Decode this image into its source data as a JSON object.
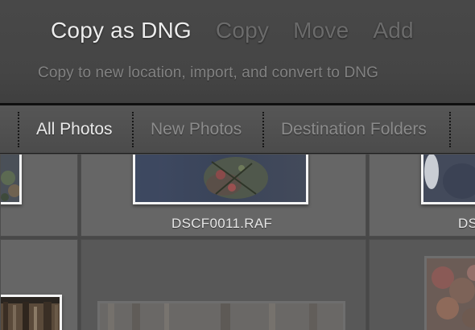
{
  "mode_tabs": [
    {
      "label": "Copy as DNG",
      "active": true
    },
    {
      "label": "Copy",
      "active": false
    },
    {
      "label": "Move",
      "active": false
    },
    {
      "label": "Add",
      "active": false
    }
  ],
  "mode_description": "Copy to new location, import, and convert to DNG",
  "filter_tabs": [
    {
      "label": "All Photos",
      "active": true
    },
    {
      "label": "New Photos",
      "active": false
    },
    {
      "label": "Destination Folders",
      "active": false
    }
  ],
  "grid": {
    "row1": [
      {
        "filename": ""
      },
      {
        "filename": "DSCF0011.RAF"
      },
      {
        "filename": "DS"
      }
    ]
  },
  "colors": {
    "header_bg": "#484848",
    "active_text": "#ececec",
    "inactive_text": "#6b6b6b",
    "thumb_border": "#f4f4f4"
  }
}
